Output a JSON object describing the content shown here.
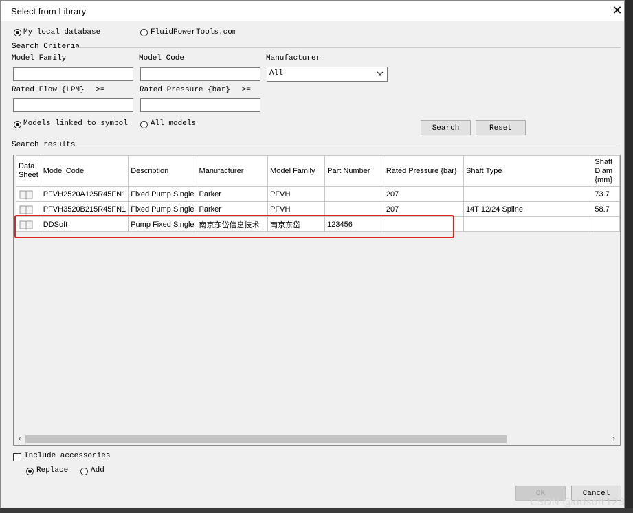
{
  "window": {
    "title": "Select from Library"
  },
  "source": {
    "local_label": "My local database",
    "remote_label": "FluidPowerTools.com",
    "selected": "local"
  },
  "criteria": {
    "group_label": "Search Criteria",
    "model_family_label": "Model Family",
    "model_family_value": "",
    "model_code_label": "Model Code",
    "model_code_value": "",
    "manufacturer_label": "Manufacturer",
    "manufacturer_value": "All",
    "rated_flow_label": "Rated Flow {LPM}",
    "rated_flow_op": ">=",
    "rated_flow_value": "",
    "rated_pressure_label": "Rated Pressure {bar}",
    "rated_pressure_op": ">=",
    "rated_pressure_value": "",
    "linked_label": "Models linked to symbol",
    "all_label": "All models",
    "scope_selected": "linked",
    "search_button": "Search",
    "reset_button": "Reset"
  },
  "results": {
    "group_label": "Search results",
    "columns": [
      "Data Sheet",
      "Model Code",
      "Description",
      "Manufacturer",
      "Model Family",
      "Part Number",
      "Rated Pressure {bar}",
      "Shaft Type",
      "Shaft Diam {mm}"
    ],
    "rows": [
      {
        "model_code": "PFVH2520A125R45FN1",
        "description": "Fixed  Pump Single",
        "manufacturer": "Parker",
        "model_family": "PFVH",
        "part_number": "",
        "rated_pressure": "207",
        "shaft_type": "",
        "shaft_diam": "73.7"
      },
      {
        "model_code": "PFVH3520B215R45FN1",
        "description": "Fixed  Pump Single",
        "manufacturer": "Parker",
        "model_family": "PFVH",
        "part_number": "",
        "rated_pressure": "207",
        "shaft_type": "14T 12/24 Spline",
        "shaft_diam": "58.7"
      },
      {
        "model_code": "DDSoft",
        "description": "Pump Fixed Single",
        "manufacturer": "南京东岱信息技术",
        "model_family": "南京东岱",
        "part_number": "123456",
        "rated_pressure": "",
        "shaft_type": "",
        "shaft_diam": ""
      }
    ]
  },
  "footer": {
    "include_accessories_label": "Include accessories",
    "include_accessories_checked": false,
    "replace_label": "Replace",
    "add_label": "Add",
    "mode_selected": "replace",
    "ok_button": "OK",
    "cancel_button": "Cancel"
  },
  "watermark": "CSDN @ddsoft123",
  "colors": {
    "highlight": "#e02020",
    "dialog_bg": "#f0f0f0"
  }
}
